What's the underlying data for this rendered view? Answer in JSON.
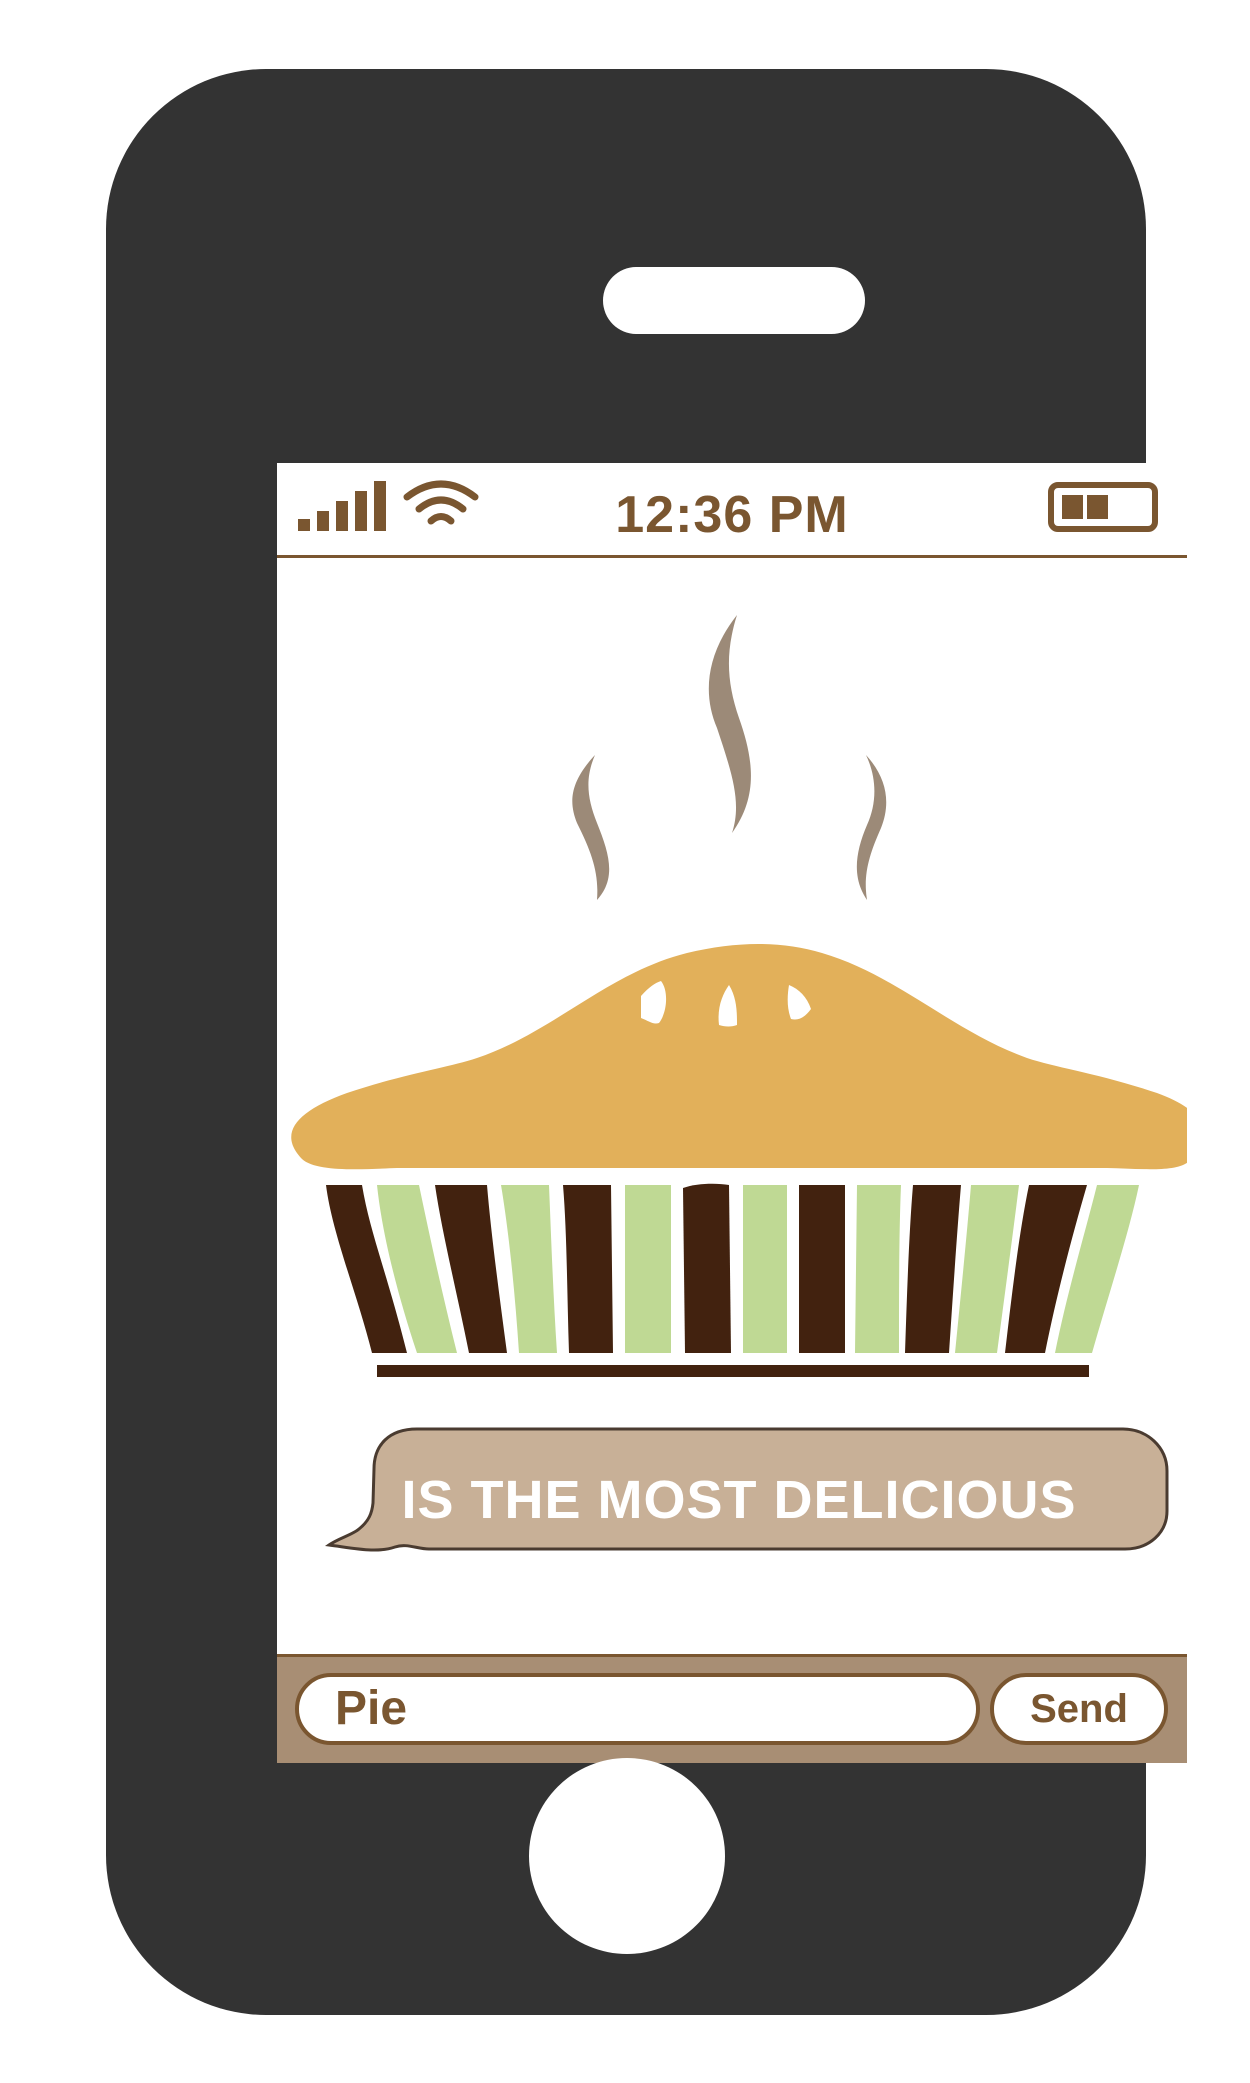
{
  "status_bar": {
    "time": "12:36 PM",
    "signal_icon": "signal-bars-icon",
    "wifi_icon": "wifi-icon",
    "battery_icon": "battery-icon",
    "battery_level": 0.66
  },
  "message": {
    "text": "IS THE MOST DELICIOUS"
  },
  "composer": {
    "input_value": "Pie",
    "send_label": "Send"
  },
  "colors": {
    "phone_body": "#333333",
    "accent_brown": "#7a5630",
    "crust": "#e2b05a",
    "pan_dark": "#42220f",
    "pan_light": "#bfd994",
    "bubble": "#c8b097",
    "input_bar": "#a88e74",
    "steam": "#9c8a78"
  }
}
